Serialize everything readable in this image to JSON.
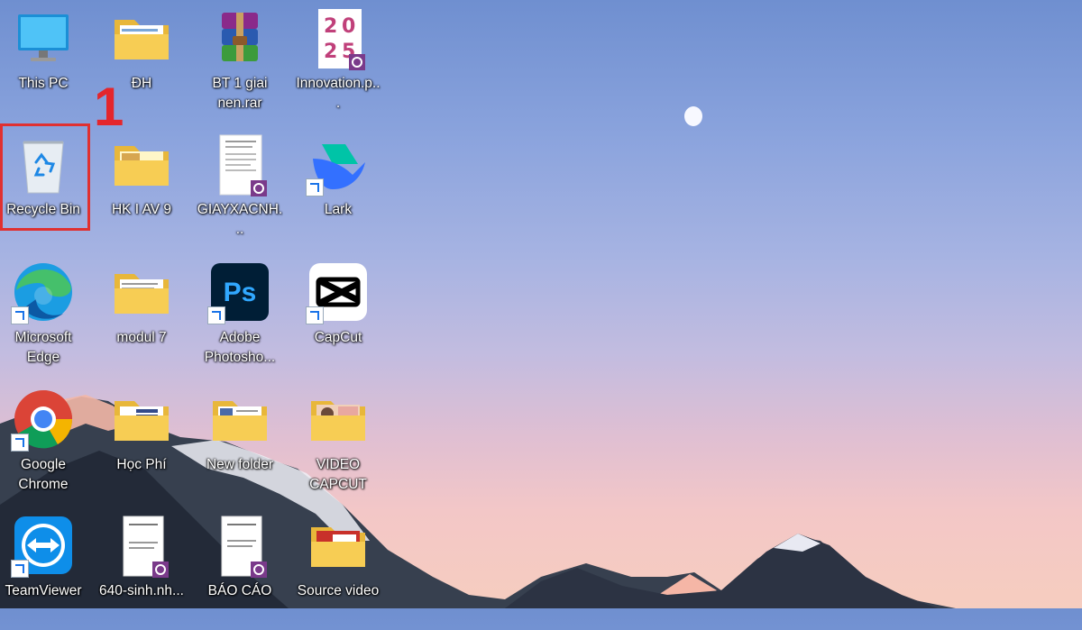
{
  "desktop": {
    "step_marker": "1",
    "icons": [
      {
        "label": "This PC"
      },
      {
        "label": "ĐH"
      },
      {
        "label": "BT 1 giai nen.rar"
      },
      {
        "label": "Innovation.p..."
      },
      {
        "label": "Recycle Bin"
      },
      {
        "label": "HK I AV 9"
      },
      {
        "label": "GIAYXACNH..."
      },
      {
        "label": "Lark"
      },
      {
        "label": "Microsoft Edge"
      },
      {
        "label": "modul 7"
      },
      {
        "label": "Adobe Photosho..."
      },
      {
        "label": "CapCut"
      },
      {
        "label": "Google Chrome"
      },
      {
        "label": "Học Phí"
      },
      {
        "label": "New folder"
      },
      {
        "label": "VIDEO CAPCUT"
      },
      {
        "label": "TeamViewer"
      },
      {
        "label": "640-sinh.nh..."
      },
      {
        "label": "BÁO CÁO"
      },
      {
        "label": "Source video"
      }
    ],
    "badges": {
      "photoshop": "Ps",
      "innovation_digits": [
        "2",
        "0",
        "2",
        "5"
      ]
    }
  }
}
